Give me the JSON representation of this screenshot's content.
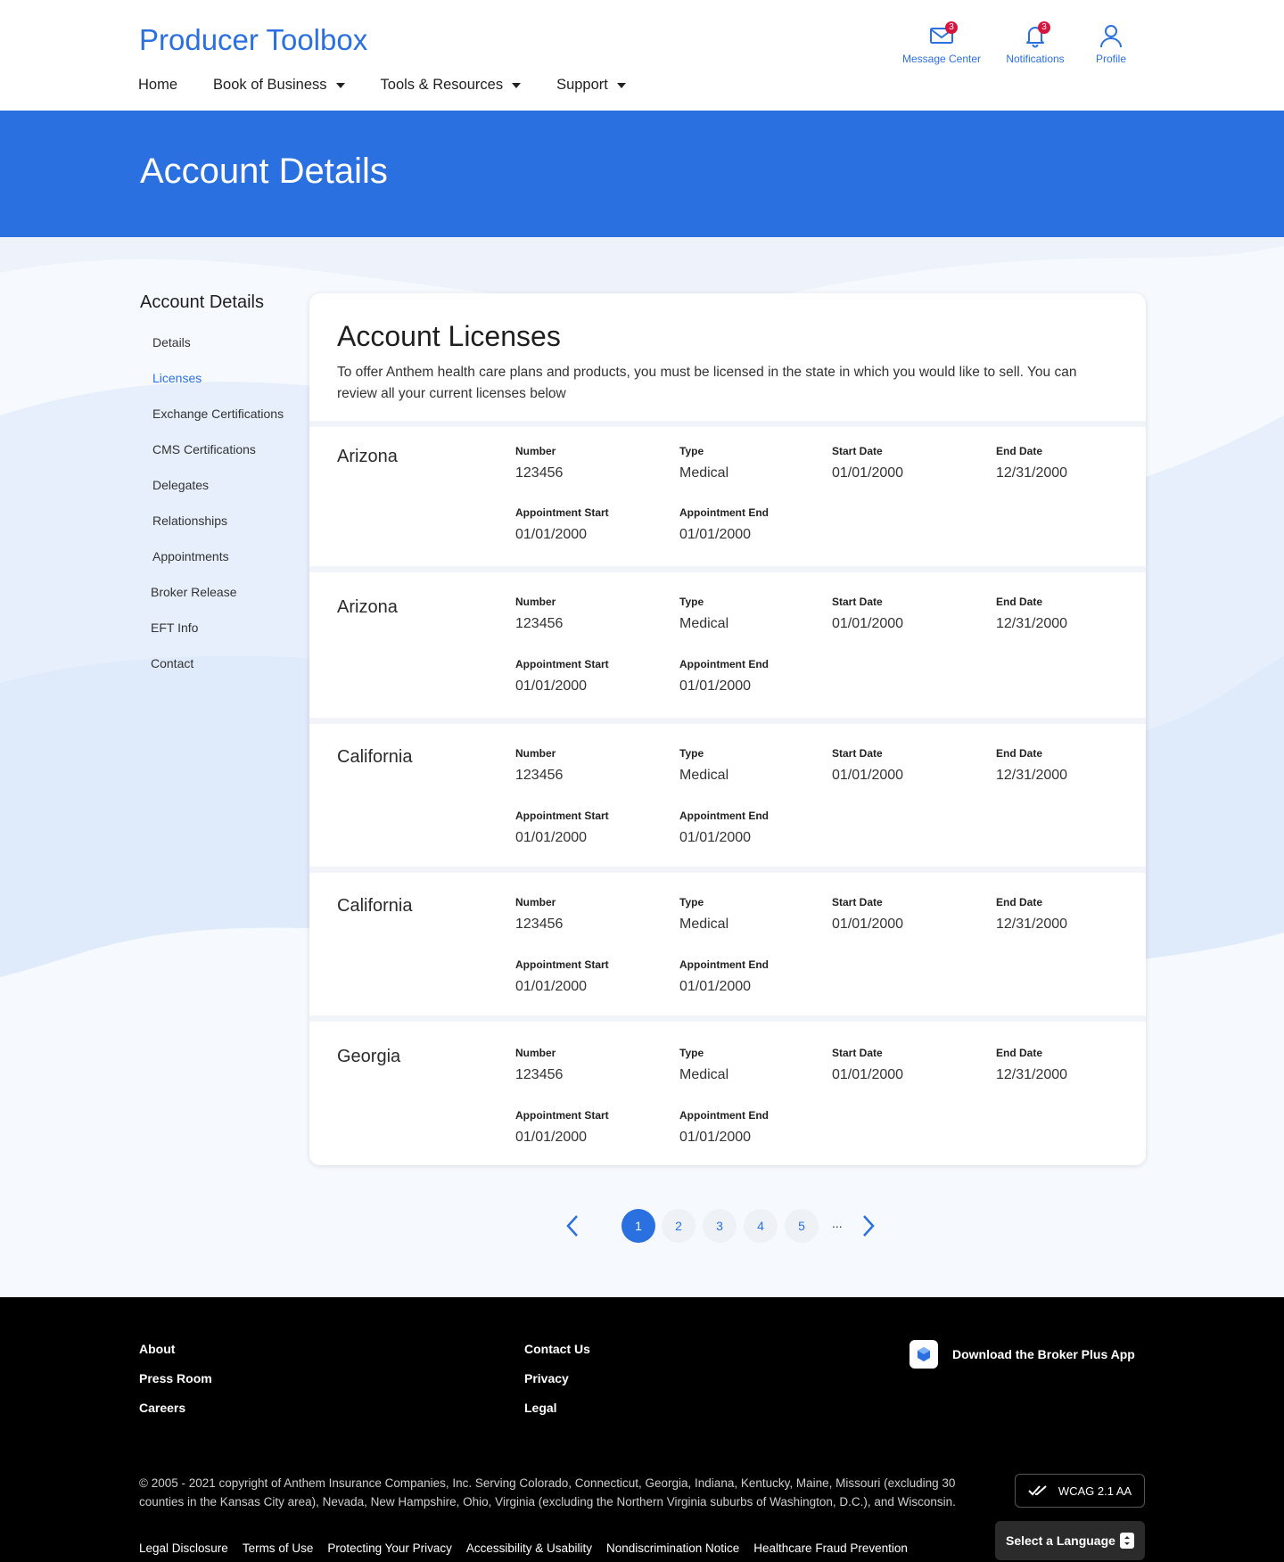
{
  "header": {
    "brand": "Producer Toolbox",
    "nav": [
      {
        "label": "Home",
        "dropdown": false
      },
      {
        "label": "Book of Business",
        "dropdown": true
      },
      {
        "label": "Tools & Resources",
        "dropdown": true
      },
      {
        "label": "Support",
        "dropdown": true
      }
    ],
    "icons": {
      "message_center": {
        "label": "Message Center",
        "badge": "3",
        "icon": "envelope-icon"
      },
      "notifications": {
        "label": "Notifications",
        "badge": "3",
        "icon": "bell-icon"
      },
      "profile": {
        "label": "Profile",
        "icon": "user-icon"
      }
    }
  },
  "hero": {
    "title": "Account Details"
  },
  "sidenav": {
    "title": "Account Details",
    "items": [
      {
        "label": "Details",
        "active": false
      },
      {
        "label": "Licenses",
        "active": true
      },
      {
        "label": "Exchange Certifications",
        "active": false
      },
      {
        "label": "CMS Certifications",
        "active": false
      },
      {
        "label": "Delegates",
        "active": false
      },
      {
        "label": "Relationships",
        "active": false
      },
      {
        "label": "Appointments",
        "active": false
      },
      {
        "label": "Broker Release",
        "active": false
      },
      {
        "label": "EFT Info",
        "active": false
      },
      {
        "label": "Contact",
        "active": false
      }
    ]
  },
  "licenses": {
    "title": "Account Licenses",
    "description": "To offer Anthem health care plans and products, you must be licensed in the state in which you would like to sell. You can review all your current licenses below",
    "field_labels": {
      "number": "Number",
      "type": "Type",
      "start_date": "Start Date",
      "end_date": "End Date",
      "appointment_start": "Appointment Start",
      "appointment_end": "Appointment End"
    },
    "rows": [
      {
        "state": "Arizona",
        "number": "123456",
        "type": "Medical",
        "start_date": "01/01/2000",
        "end_date": "12/31/2000",
        "appointment_start": "01/01/2000",
        "appointment_end": "01/01/2000"
      },
      {
        "state": "Arizona",
        "number": "123456",
        "type": "Medical",
        "start_date": "01/01/2000",
        "end_date": "12/31/2000",
        "appointment_start": "01/01/2000",
        "appointment_end": "01/01/2000"
      },
      {
        "state": "California",
        "number": "123456",
        "type": "Medical",
        "start_date": "01/01/2000",
        "end_date": "12/31/2000",
        "appointment_start": "01/01/2000",
        "appointment_end": "01/01/2000"
      },
      {
        "state": "California",
        "number": "123456",
        "type": "Medical",
        "start_date": "01/01/2000",
        "end_date": "12/31/2000",
        "appointment_start": "01/01/2000",
        "appointment_end": "01/01/2000"
      },
      {
        "state": "Georgia",
        "number": "123456",
        "type": "Medical",
        "start_date": "01/01/2000",
        "end_date": "12/31/2000",
        "appointment_start": "01/01/2000",
        "appointment_end": "01/01/2000"
      }
    ]
  },
  "pagination": {
    "pages": [
      "1",
      "2",
      "3",
      "4",
      "5"
    ],
    "current": "1",
    "ellipsis": "...",
    "prev_icon": "chevron-left-icon",
    "next_icon": "chevron-right-icon"
  },
  "footer": {
    "col1": [
      "About",
      "Press Room",
      "Careers"
    ],
    "col2": [
      "Contact Us",
      "Privacy",
      "Legal"
    ],
    "app_download": "Download the Broker Plus App",
    "copyright": "© 2005 - 2021 copyright of Anthem Insurance Companies, Inc. Serving Colorado, Connecticut, Georgia, Indiana, Kentucky, Maine, Missouri (excluding 30 counties in the Kansas City area), Nevada, New Hampshire, Ohio, Virginia (excluding the Northern Virginia suburbs of Washington, D.C.), and Wisconsin.",
    "wcag": "WCAG 2.1 AA",
    "legal_links": [
      "Legal Disclosure",
      "Terms of Use",
      "Protecting Your Privacy",
      "Accessibility & Usability",
      "Nondiscrimination Notice",
      "Healthcare Fraud Prevention"
    ],
    "language_select": "Select a Language"
  },
  "colors": {
    "brand_blue": "#2a70e0",
    "badge_red": "#d6163f",
    "footer_bg": "#000000"
  }
}
